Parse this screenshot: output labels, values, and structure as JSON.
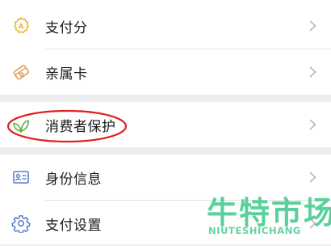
{
  "menu": {
    "payscore_label": "支付分",
    "family_card_label": "亲属卡",
    "consumer_protection_label": "消费者保护",
    "identity_info_label": "身份信息",
    "payment_settings_label": "支付设置"
  },
  "icons": {
    "payscore": "payscore-badge-icon",
    "family_card": "family-card-icon",
    "consumer_protection": "leaf-protection-icon",
    "identity_info": "id-card-icon",
    "payment_settings": "gear-icon",
    "chevron": "chevron-right-icon"
  },
  "colors": {
    "payscore_icon": "#e8b73c",
    "family_card_icon": "#e29a5a",
    "consumer_protection_icon": "#5bb04a",
    "identity_info_icon": "#5a7ec7",
    "payment_settings_icon": "#5a7ec7",
    "highlight_ellipse": "#e02020",
    "watermark": "#3ec98a"
  },
  "watermark": {
    "cn": "牛特市场",
    "en": "NIUTESHICHANG"
  }
}
